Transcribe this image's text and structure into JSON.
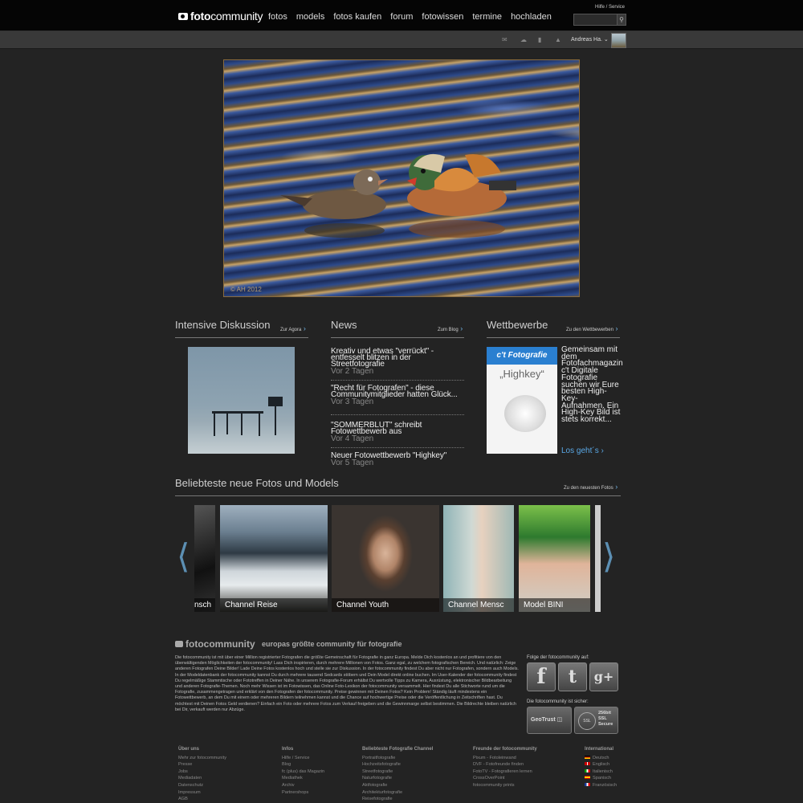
{
  "header": {
    "logo_bold": "foto",
    "logo_thin": "community",
    "nav": [
      "fotos",
      "models",
      "fotos kaufen",
      "forum",
      "fotowissen",
      "termine",
      "hochladen"
    ],
    "help": "Hilfe / Service",
    "search_placeholder": "",
    "search_icon": "magnifier-icon"
  },
  "userbar": {
    "icons": [
      "mail-icon",
      "chat-icon",
      "comment-icon",
      "notification-icon"
    ],
    "username": "Andreas Ha.",
    "dropdown_icon": "chevron-down-icon"
  },
  "hero": {
    "credit": "© AH 2012"
  },
  "sections": {
    "discussion": {
      "title": "Intensive Diskussion",
      "link": "Zur Agora"
    },
    "news": {
      "title": "News",
      "link": "Zum Blog"
    },
    "contests": {
      "title": "Wettbewerbe",
      "link": "Zu den Wettbewerben"
    },
    "popular": {
      "title": "Beliebteste neue Fotos und Models",
      "link": "Zu den neuesten Fotos"
    }
  },
  "news": [
    {
      "title": "Kreativ und etwas \"verrückt\" - entfesselt blitzen in der Streetfotografie",
      "age": "Vor 2 Tagen"
    },
    {
      "title": "\"Recht für Fotografen\" - diese Communitymitglieder hatten Glück...",
      "age": "Vor 3 Tagen"
    },
    {
      "title": "\"SOMMERBLUT\" schreibt Fotowettbewerb aus",
      "age": "Vor 4 Tagen"
    },
    {
      "title": "Neuer Fotowettbewerb \"Highkey\"",
      "age": "Vor 5 Tagen"
    }
  ],
  "contest": {
    "brand": "c't Fotografie",
    "word": "„Highkey“",
    "text": "Gemeinsam mit dem Fotofachmagazin c't Digitale Fotografie suchen wir Eure besten High-Key-Aufnahmen. Ein High-Key Bild ist stets korrekt...",
    "cta": "Los geht´s"
  },
  "carousel": [
    {
      "caption": "nsch"
    },
    {
      "caption": "Channel Reise"
    },
    {
      "caption": "Channel Youth"
    },
    {
      "caption": "Channel Mensc"
    },
    {
      "caption": "Model BINI"
    }
  ],
  "footer": {
    "logo_bold": "foto",
    "logo_thin": "community",
    "slogan": "europas größte community für fotografie",
    "description": "Die fotocommunity ist mit über einer Million registrierter Fotografen die größte Gemeinschaft für Fotografie in ganz Europa. Melde Dich kostenlos an und profitiere von den überwältigenden Möglichkeiten der fotocommunity! Lass Dich inspirieren, durch mehrere Millionen von Fotos. Ganz egal, zu welchem fotografischen Bereich. Und natürlich: Zeige anderen Fotografen Deine Bilder! Lade Deine Fotos kostenlos hoch und stelle sie zur Diskussion. In der fotocommunity findest Du aber nicht nur Fotografen, sondern auch Models. In der Modeldatenbank der fotocommunity kannst Du durch mehrere tausend Sedcards stöbern und Dein Model direkt online buchen. Im User-Kalender der fotocommunity findest Du regelmäßige Stammtische oder Fototreffen in Deiner Nähe. In unserem Fotografie-Forum erhältst Du wertvolle Tipps zu Kamera, Ausrüstung, elektronischer Bildbearbeitung und anderen Fotografie-Themen. Noch mehr Wissen ist im Fotowissen, das Online Foto-Lexikon der fotocommunity versammelt. Hier findest Du alle Stichworte rund um die Fotografie, zusammengetragen und erklärt von den Fotografen der fotocommunity. Preise gewinnen mit Deinen Fotos? Kein Problem! Ständig läuft mindestens ein Fotowettbewerb, an dem Du mit einem oder mehreren Bildern teilnehmen kannst und die Chance auf hochwertige Preise oder die Veröffentlichung in Zeitschriften hast. Du möchtest mit Deinen Fotos Geld verdienen? Einfach ein Foto oder mehrere Fotos zum Verkauf freigeben und die Gewinnmarge selbst bestimmen. Die Bildrechte bleiben natürlich bei Dir, verkauft werden nur Abzüge.",
    "follow": "Folge der fotocommunity auf:",
    "social": [
      {
        "label": "f",
        "icon": "facebook-icon"
      },
      {
        "label": "t",
        "icon": "twitter-icon"
      },
      {
        "label": "g+",
        "icon": "google-plus-icon"
      }
    ],
    "secure": "Die fotocommunity ist sicher:",
    "badge1": "GeoTrust",
    "badge2_line1": "256bit",
    "badge2_line2": "SSL",
    "badge2_line3": "Secure",
    "badge2_seal": "SSL",
    "columns": [
      {
        "heading": "Über uns",
        "items": [
          "Mehr zur fotocommunity",
          "Presse",
          "Jobs",
          "Mediadaten",
          "Datenschutz",
          "Impressum",
          "AGB"
        ]
      },
      {
        "heading": "Infos",
        "items": [
          "Hilfe / Service",
          "Blog",
          "fc (plus) das Magazin",
          "Mediathek",
          "Archiv",
          "Partnershops"
        ]
      },
      {
        "heading": "Beliebteste Fotografie Channel",
        "items": [
          "Portraitfotografie",
          "Hochzeitsfotografie",
          "Streetfotografie",
          "Naturfotografie",
          "Aktfotografie",
          "Architekturfotografie",
          "Reisefotografie"
        ]
      },
      {
        "heading": "Freunde der fotocommunity",
        "items": [
          "Pixum - Fotoleinwand",
          "DVF - Fotofreunde finden",
          "FotoTV - Fotografieren lernen",
          "CrossOverPoint",
          "fotocommunity prints"
        ]
      },
      {
        "heading": "International",
        "items": [
          "Deutsch",
          "Englisch",
          "Italienisch",
          "Spanisch",
          "Französisch"
        ]
      }
    ]
  },
  "colors": {
    "accent": "#5aa8e6",
    "background": "#232323",
    "topbar": "#050505"
  }
}
